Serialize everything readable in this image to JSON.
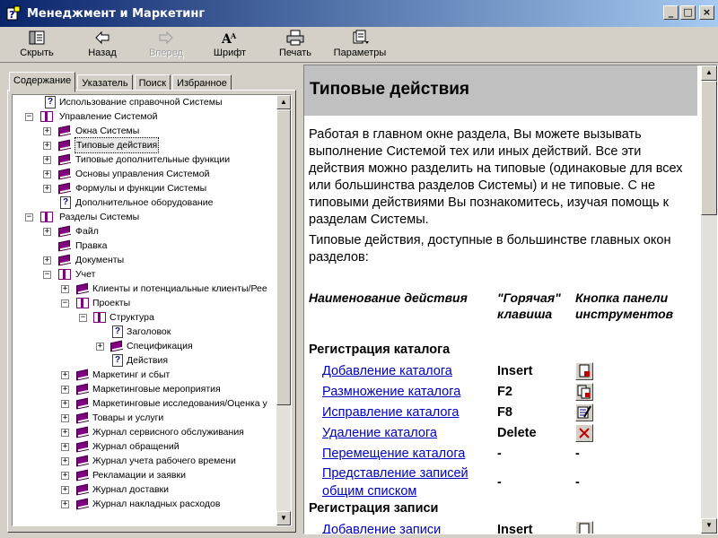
{
  "window": {
    "title": "Менеджмент и  Маркетинг",
    "controls": {
      "minimize": "_",
      "maximize": "□",
      "close": "×"
    }
  },
  "toolbar": {
    "hide": "Скрыть",
    "back": "Назад",
    "forward": "Вперед",
    "font": "Шрифт",
    "print": "Печать",
    "options": "Параметры"
  },
  "tabs": {
    "contents": "Содержание",
    "index": "Указатель",
    "search": "Поиск",
    "favorites": "Избранное"
  },
  "tree": [
    "Использование справочной Системы",
    "Управление Системой",
    "Окна Системы",
    "Типовые действия",
    "Типовые дополнительные функции",
    "Основы управления Системой",
    "Формулы и функции Системы",
    "Дополнительное оборудование",
    "Разделы Системы",
    "Файл",
    "Правка",
    "Документы",
    "Учет",
    "Клиенты и потенциальные клиенты/Рее",
    "Проекты",
    "Структура",
    "Заголовок",
    "Спецификация",
    "Действия",
    "Маркетинг и сбыт",
    "Маркетинговые мероприятия",
    "Маркетинговые исследования/Оценка у",
    "Товары и услуги",
    "Журнал сервисного обслуживания",
    "Журнал обращений",
    "Журнал учета рабочего времени",
    "Рекламации и заявки",
    "Журнал доставки",
    "Журнал накладных расходов"
  ],
  "content": {
    "title": "Типовые действия",
    "para1": "Работая в главном окне раздела, Вы можете вызывать выполнение Системой тех или иных действий. Все эти действия можно разделить на типовые (одинаковые для всех или большинства разделов Системы) и не типовые. С не типовыми действиями Вы познакомитесь, изучая помощь к разделам Системы.",
    "para2": "Типовые действия, доступные в большинстве главных окон разделов:",
    "col_action": "Наименование действия",
    "col_hotkey": "\"Горячая\" клавиша",
    "col_button": "Кнопка панели инструментов",
    "section1": "Регистрация каталога",
    "section2": "Регистрация записи",
    "actions": [
      {
        "name": "Добавление каталога",
        "key": "Insert",
        "icon": "add-catalog-icon"
      },
      {
        "name": "Размножение каталога",
        "key": "F2",
        "icon": "duplicate-catalog-icon"
      },
      {
        "name": "Исправление каталога",
        "key": "F8",
        "icon": "edit-catalog-icon"
      },
      {
        "name": "Удаление каталога",
        "key": "Delete",
        "icon": "delete-icon"
      },
      {
        "name": "Перемещение каталога",
        "key": "-",
        "icon": "-"
      },
      {
        "name1": "Представление записей",
        "name2": "общим списком",
        "key": "-",
        "icon": "-"
      },
      {
        "name": "Добавление записи",
        "key": "Insert",
        "icon": "add-record-icon"
      }
    ]
  }
}
